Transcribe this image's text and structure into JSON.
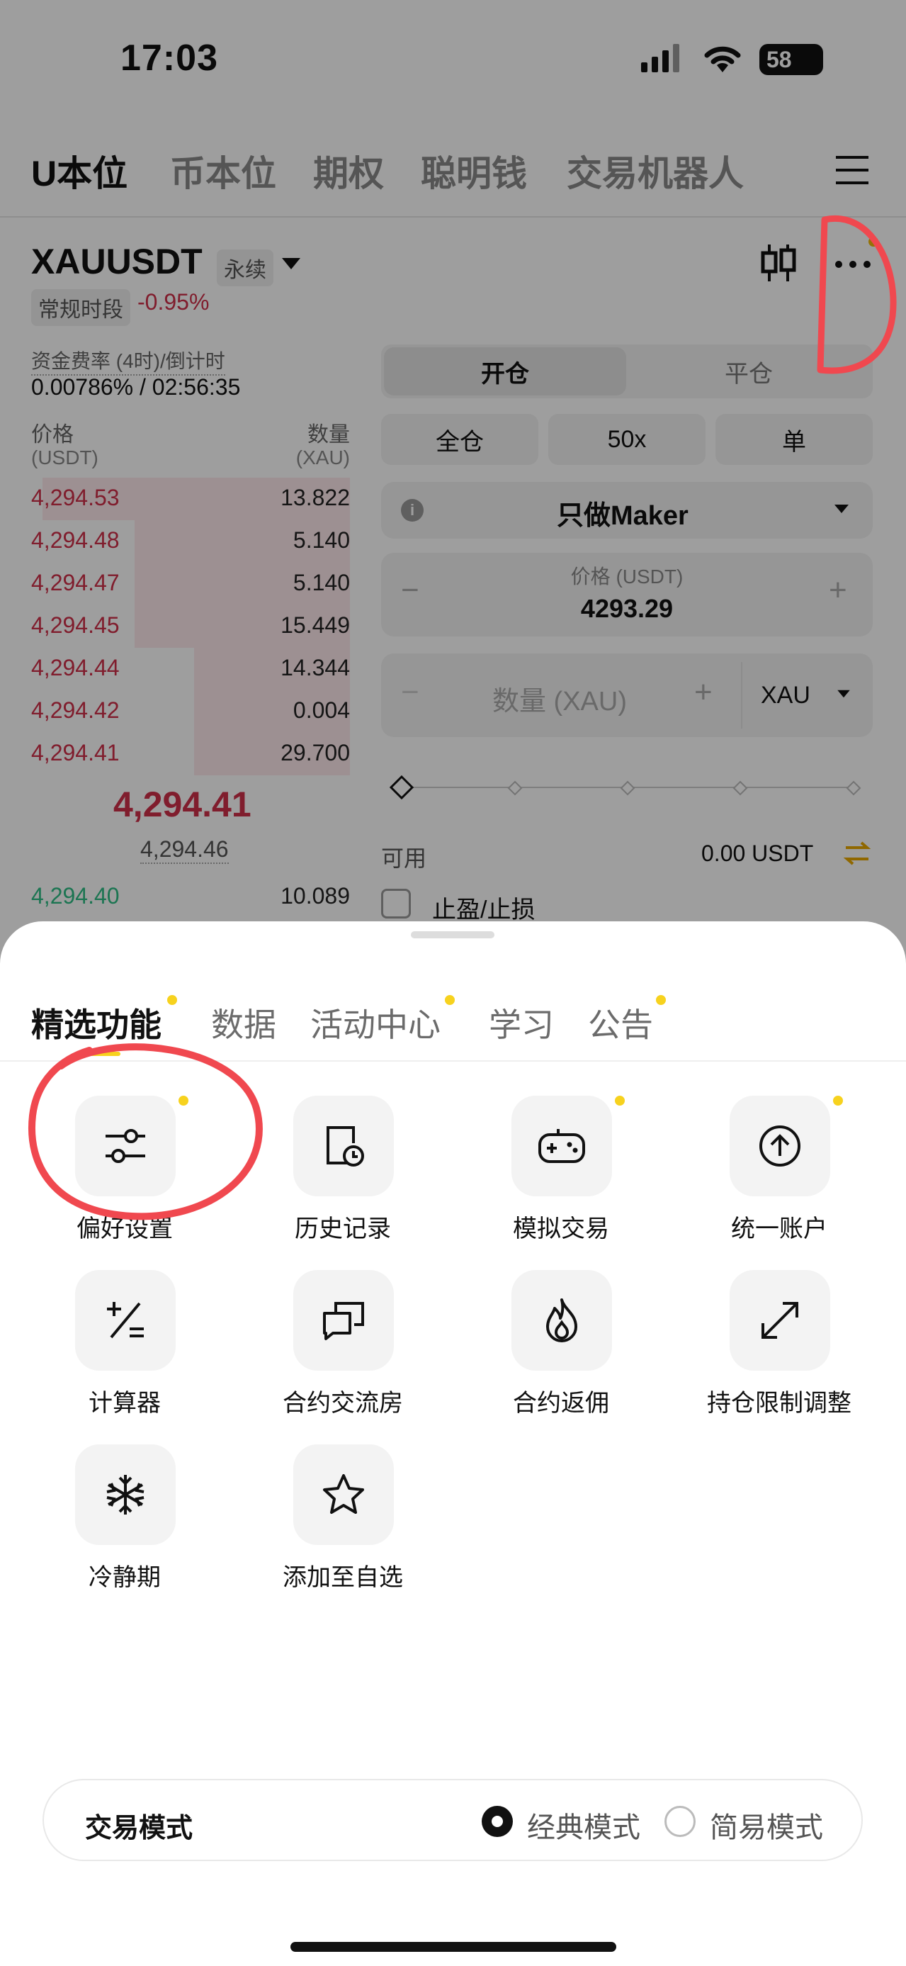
{
  "status_bar": {
    "time": "17:03",
    "battery": "58"
  },
  "top_tabs": [
    "U本位",
    "币本位",
    "期权",
    "聪明钱",
    "交易机器人"
  ],
  "symbol": {
    "name": "XAUUSDT",
    "contract_type": "永续",
    "session": "常规时段",
    "change": "-0.95%"
  },
  "funding": {
    "label": "资金费率 (4时)/倒计时",
    "value": "0.00786% / 02:56:35"
  },
  "orderbook": {
    "price_header": "价格",
    "price_unit": "(USDT)",
    "qty_header": "数量",
    "qty_unit": "(XAU)",
    "asks": [
      {
        "price": "4,294.53",
        "qty": "13.822"
      },
      {
        "price": "4,294.48",
        "qty": "5.140"
      },
      {
        "price": "4,294.47",
        "qty": "5.140"
      },
      {
        "price": "4,294.45",
        "qty": "15.449"
      },
      {
        "price": "4,294.44",
        "qty": "14.344"
      },
      {
        "price": "4,294.42",
        "qty": "0.004"
      },
      {
        "price": "4,294.41",
        "qty": "29.700"
      }
    ],
    "last_price": "4,294.41",
    "mark_price": "4,294.46",
    "bids": [
      {
        "price": "4,294.40",
        "qty": "10.089"
      }
    ]
  },
  "order_panel": {
    "open_tab": "开仓",
    "close_tab": "平仓",
    "margin_mode": "全仓",
    "leverage": "50x",
    "position_mode": "单",
    "order_type": "只做Maker",
    "price_label": "价格 (USDT)",
    "price_value": "4293.29",
    "minus": "−",
    "plus": "+",
    "qty_placeholder": "数量 (XAU)",
    "qty_unit": "XAU",
    "available_label": "可用",
    "available_value": "0.00 USDT",
    "tpsl_label": "止盈/止损"
  },
  "sheet": {
    "tabs": [
      {
        "label": "精选功能",
        "dot": true
      },
      {
        "label": "数据",
        "dot": false
      },
      {
        "label": "活动中心",
        "dot": true
      },
      {
        "label": "学习",
        "dot": false
      },
      {
        "label": "公告",
        "dot": true
      }
    ],
    "features": [
      {
        "label": "偏好设置",
        "icon": "sliders-icon",
        "dot": true
      },
      {
        "label": "历史记录",
        "icon": "history-icon",
        "dot": false
      },
      {
        "label": "模拟交易",
        "icon": "gamepad-icon",
        "dot": true
      },
      {
        "label": "统一账户",
        "icon": "arrow-up-circle-icon",
        "dot": true
      },
      {
        "label": "计算器",
        "icon": "calculator-icon",
        "dot": false
      },
      {
        "label": "合约交流房",
        "icon": "chat-icon",
        "dot": false
      },
      {
        "label": "合约返佣",
        "icon": "flame-icon",
        "dot": false
      },
      {
        "label": "持仓限制调整",
        "icon": "expand-icon",
        "dot": false
      },
      {
        "label": "冷静期",
        "icon": "snowflake-icon",
        "dot": false
      },
      {
        "label": "添加至自选",
        "icon": "star-icon",
        "dot": false
      }
    ],
    "mode_label": "交易模式",
    "mode_classic": "经典模式",
    "mode_simple": "简易模式"
  },
  "colors": {
    "ask": "#cf304a",
    "bid": "#2ebd85",
    "accent": "#f7d21e",
    "annotation": "#f0484f"
  }
}
